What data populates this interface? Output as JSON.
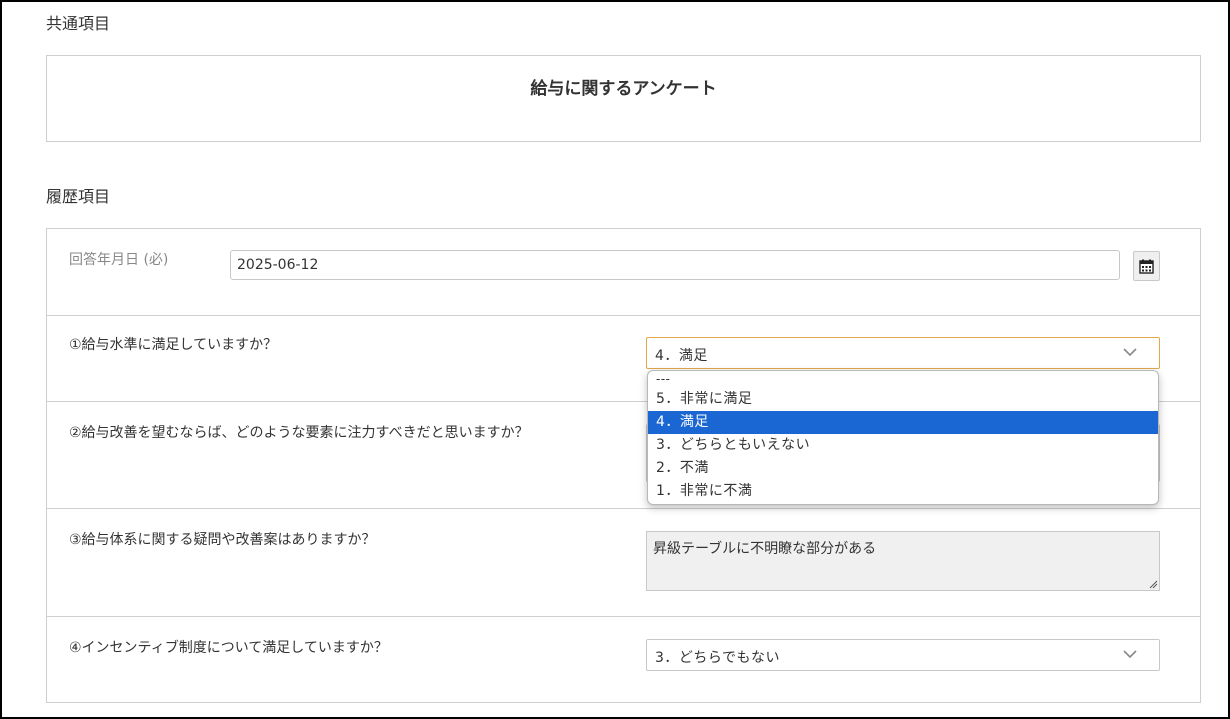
{
  "common_section": {
    "heading": "共通項目",
    "survey_title": "給与に関するアンケート"
  },
  "history_section": {
    "heading": "履歴項目",
    "answer_date": {
      "label": "回答年月日 (必)",
      "value": "2025-06-12"
    },
    "q1": {
      "label": "①給与水準に満足していますか？",
      "selected": "4．満足",
      "options": [
        "---",
        "5．非常に満足",
        "4．満足",
        "3．どちらともいえない",
        "2．不満",
        "1．非常に不満"
      ]
    },
    "q2": {
      "label": "②給与改善を望むならば、どのような要素に注力すべきだと思いますか？"
    },
    "q3": {
      "label": "③給与体系に関する疑問や改善案はありますか？",
      "value": "昇級テーブルに不明瞭な部分がある"
    },
    "q4": {
      "label": "④インセンティブ制度について満足していますか？",
      "selected": "3．どちらでもない"
    }
  },
  "colors": {
    "highlight": "#1a66d2",
    "focus_border": "#e0a84a",
    "border": "#cfcfcf"
  }
}
